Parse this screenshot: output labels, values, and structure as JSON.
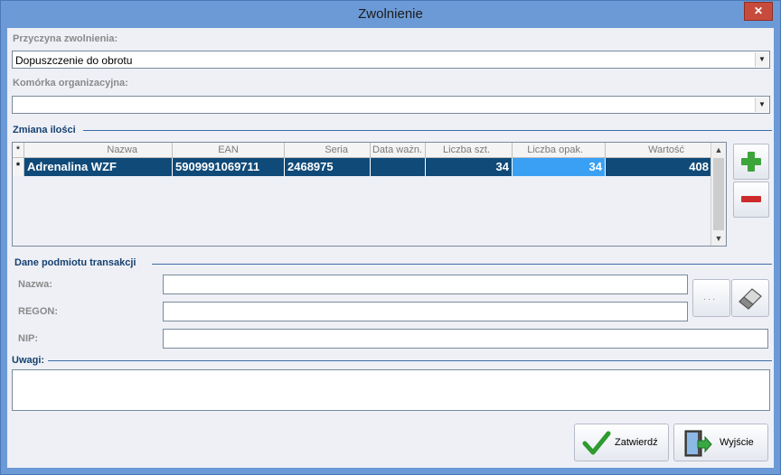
{
  "window": {
    "title": "Zwolnienie",
    "close_glyph": "✕"
  },
  "reason": {
    "label": "Przyczyna zwolnienia:",
    "value": "Dopuszczenie do obrotu"
  },
  "org_unit": {
    "label": "Komórka organizacyjna:",
    "value": ""
  },
  "quantity_section": {
    "label": "Zmiana ilości"
  },
  "grid": {
    "corner_mark": "*",
    "columns": [
      "Nazwa",
      "EAN",
      "Seria",
      "Data ważn.",
      "Liczba szt.",
      "Liczba opak.",
      "Wartość"
    ],
    "rows": [
      {
        "marker": "*",
        "name": "Adrenalina WZF",
        "ean": "5909991069711",
        "series": "2468975",
        "expiry": "",
        "units": "34",
        "packages": "34",
        "value": "408"
      }
    ]
  },
  "party_section": {
    "label": "Dane podmiotu transakcji",
    "name_label": "Nazwa:",
    "regon_label": "REGON:",
    "nip_label": "NIP:",
    "name_value": "",
    "regon_value": "",
    "nip_value": "",
    "browse_label": "..."
  },
  "notes": {
    "label": "Uwagi:",
    "value": ""
  },
  "buttons": {
    "confirm": "Zatwierdź",
    "exit": "Wyjście"
  },
  "icons": {
    "add": "plus-icon",
    "remove": "minus-icon",
    "eraser": "eraser-icon",
    "confirm": "check-icon",
    "exit": "exit-door-icon"
  },
  "colors": {
    "title_bar": "#6c9ad6",
    "section_label": "#15406f",
    "row_selected": "#0f4a78",
    "cell_selected": "#3aa0f3",
    "add_green": "#3ca53a",
    "remove_red": "#cc2b2b"
  }
}
